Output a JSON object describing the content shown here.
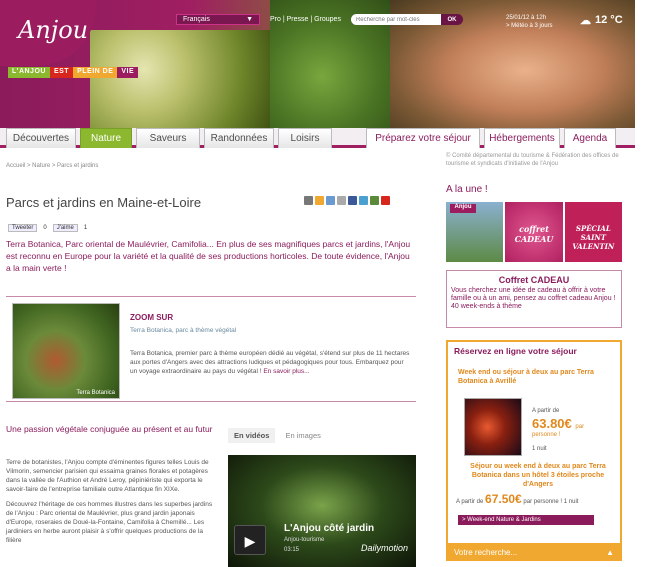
{
  "header": {
    "logo": "Anjou",
    "tagline": [
      {
        "label": "L'ANJOU",
        "color": "#8bb82e"
      },
      {
        "label": "EST",
        "color": "#d7261e"
      },
      {
        "label": "PLEIN DE",
        "color": "#f0a830"
      },
      {
        "label": "VIE",
        "color": "#9b1d60"
      }
    ],
    "language": "Français",
    "top_links": "Pro | Presse | Groupes",
    "search_placeholder": "Recherche par mot-clés",
    "search_button": "OK",
    "date": "25/01/12 à 12h",
    "meteo_link": "> Météo à 3 jours",
    "temperature": "12 °C"
  },
  "nav": {
    "tabs": [
      "Découvertes",
      "Nature",
      "Saveurs",
      "Randonnées",
      "Loisirs"
    ],
    "right_tabs": [
      "Préparez votre séjour",
      "Hébergements",
      "Agenda"
    ],
    "active": "Nature"
  },
  "breadcrumb": "Accueil > Nature > Parcs et jardins",
  "page": {
    "title": "Parcs et jardins en Maine-et-Loire",
    "tweet_label": "Tweeter",
    "tweet_count": "0",
    "like_label": "J'aime",
    "like_count": "1",
    "intro": "Terra Botanica, Parc oriental de Maulévrier, Camifolia... En plus de ses magnifiques parcs et jardins, l'Anjou est reconnu en Europe pour la variété et la qualité de ses productions horticoles. De toute évidence, l'Anjou a la main verte !"
  },
  "zoom": {
    "title": "ZOOM SUR",
    "subtitle": "Terra Botanica, parc à thème végétal",
    "image_caption": "Terra Botanica",
    "text": "Terra Botanica, premier parc à thème européen dédié au végétal, s'étend sur plus de 11 hectares aux portes d'Angers avec des attractions ludiques et pédagogiques pour tous. Embarquez pour un voyage extraordinaire au pays du végétal !",
    "link": "En savoir plus..."
  },
  "section": {
    "heading": "Une passion végétale conjuguée au présent et au futur",
    "para1": "Terre de botanistes, l'Anjou compte d'éminentes figures telles Louis de Vilmorin, semencier parisien qui essaima graines florales et potagères dans la vallée de l'Authion et André Leroy, pépiniériste qui exporta le savoir-faire de l'entreprise familiale outre Atlantique fin XIXe.",
    "para2": "Découvrez l'héritage de ces hommes illustres dans les superbes jardins de l'Anjou : Parc oriental de Maulévrier, plus grand jardin japonais d'Europe, roseraies de Doué-la-Fontaine, Camifolia à Chemillé... Les jardiniers en herbe auront plaisir à s'offrir quelques productions de la filière"
  },
  "video": {
    "tabs": [
      "En vidéos",
      "En images"
    ],
    "title": "L'Anjou côté jardin",
    "user": "Anjou-tourisme",
    "duration": "03:15",
    "brand": "Dailymotion"
  },
  "sidebar": {
    "credit": "© Comité départemental du tourisme & Fédération des offices de tourisme et syndicats d'initiative de l'Anjou",
    "une_title": "A la une !",
    "promo_badge": "Anjou",
    "promo_coffret": "coffret CADEAU",
    "promo_valentin": "SPÉCIAL SAINT VALENTIN",
    "coffret_title": "Coffret CADEAU",
    "coffret_text": "Vous cherchez une idée de cadeau à offrir à votre famille ou à un ami, pensez au coffret cadeau Anjou ! 40 week-ends à thème",
    "reserve_title": "Réservez en ligne votre séjour",
    "offer1": "Week end ou séjour à deux au parc Terra Botanica à Avrillé",
    "apartir": "A partir de",
    "price1": "63.80€",
    "price1_unit": "par",
    "per_person": "personne !",
    "nights": "1 nuit",
    "offer2": "Séjour ou week end à deux au parc Terra Botanica dans un hôtel 3 étoiles proche d'Angers",
    "price2_prefix": "A partir de",
    "price2": "67.50€",
    "price2_suffix": "par personne ! 1 nuit",
    "link": "> Week-end Nature & Jardins",
    "recherche": "Votre recherche..."
  }
}
